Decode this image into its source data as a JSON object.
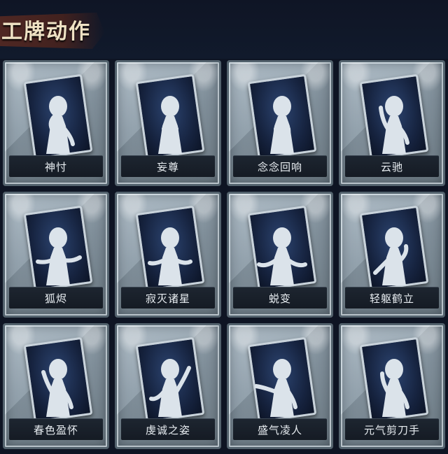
{
  "header": {
    "title": "工牌动作"
  },
  "cards": [
    {
      "label": "神忖",
      "pose": "hand-to-chin"
    },
    {
      "label": "妄尊",
      "pose": "arms-crossed-low"
    },
    {
      "label": "念念回响",
      "pose": "hug-object"
    },
    {
      "label": "云驰",
      "pose": "hand-raised-staff"
    },
    {
      "label": "狐烬",
      "pose": "arm-extended-side"
    },
    {
      "label": "寂灭诸星",
      "pose": "hands-open-orb"
    },
    {
      "label": "蜕变",
      "pose": "arms-spread"
    },
    {
      "label": "轻躯鹤立",
      "pose": "graceful-side"
    },
    {
      "label": "春色盈怀",
      "pose": "flower-hand"
    },
    {
      "label": "虔诚之姿",
      "pose": "arm-raised"
    },
    {
      "label": "盛气凌人",
      "pose": "pointing"
    },
    {
      "label": "元气剪刀手",
      "pose": "peace-sign"
    }
  ]
}
